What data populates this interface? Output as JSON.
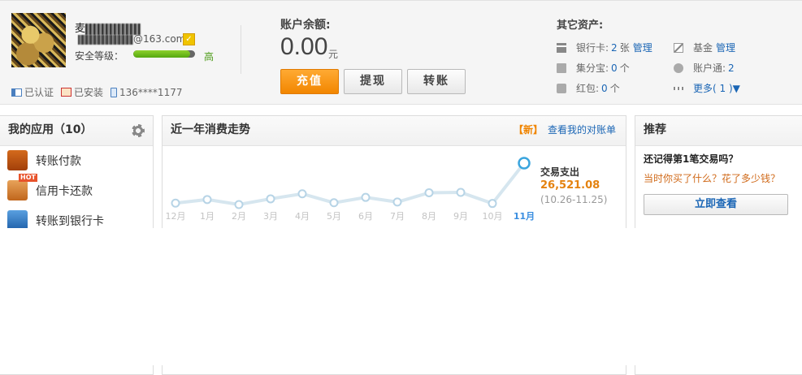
{
  "user": {
    "name_prefix": "麦",
    "email_suffix": "@163.com",
    "security_label": "安全等级：",
    "security_level": "高",
    "security_progress": 0.92,
    "status": [
      {
        "icon": "id-card-icon",
        "label": "已认证"
      },
      {
        "icon": "certificate-icon",
        "label": "已安装"
      },
      {
        "icon": "phone-icon",
        "label": "136****1177"
      }
    ]
  },
  "balance": {
    "label": "账户余额:",
    "amount": "0.00",
    "unit": "元",
    "buttons": {
      "recharge": "充值",
      "withdraw": "提现",
      "transfer": "转账"
    }
  },
  "assets": {
    "title": "其它资产:",
    "bank": {
      "label": "银行卡:",
      "value": "2",
      "unit": "张",
      "manage": "管理"
    },
    "jifenbao": {
      "label": "集分宝:",
      "value": "0",
      "unit": "个"
    },
    "hongbao": {
      "label": "红包:",
      "value": "0",
      "unit": "个"
    },
    "fund": {
      "label": "基金",
      "manage": "管理"
    },
    "zhanghutong": {
      "label": "账户通:",
      "value": "2"
    },
    "more": "更多( 1 )▼"
  },
  "apps": {
    "title": "我的应用（10）",
    "items": [
      {
        "label": "转账付款",
        "icon": "transfer-icon"
      },
      {
        "label": "信用卡还款",
        "icon": "credit-card-icon",
        "badge": "HOT"
      },
      {
        "label": "转账到银行卡",
        "icon": "bank-card-icon"
      }
    ]
  },
  "trend": {
    "title": "近一年消费走势",
    "new_tag": "【新】",
    "bill_link": "查看我的对账单",
    "detail_label": "交易支出",
    "detail_amount": "26,521.08",
    "detail_period": "(10.26-11.25)"
  },
  "chart_data": {
    "type": "line",
    "categories": [
      "12月",
      "1月",
      "2月",
      "3月",
      "4月",
      "5月",
      "6月",
      "7月",
      "8月",
      "9月",
      "10月",
      "11月"
    ],
    "series": [
      {
        "values": [
          2100,
          3100,
          1700,
          3300,
          4700,
          2200,
          3700,
          2400,
          5000,
          5100,
          2000,
          26521.08
        ]
      }
    ],
    "highlight_index": 11,
    "colors": {
      "line": "#d6e6ef",
      "point_fill": "#ffffff",
      "point_stroke": "#b7d4e6",
      "highlight": "#3ba5de",
      "label": "#c3c3c3",
      "label_active": "#3a8ee0"
    }
  },
  "recommend": {
    "title": "推荐",
    "question": "还记得第1笔交易吗？",
    "subtitle": "当时你买了什么？花了多少钱？",
    "button": "立即查看"
  }
}
